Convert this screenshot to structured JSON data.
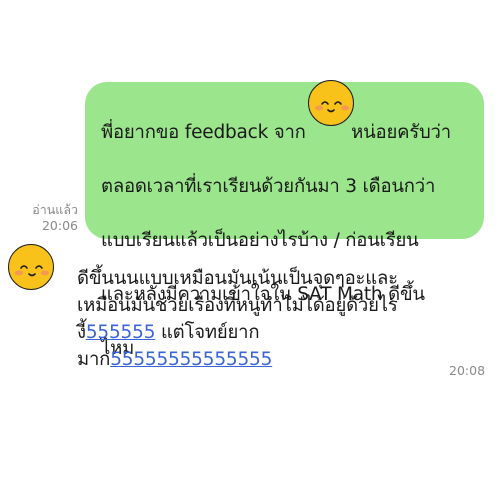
{
  "outgoing": {
    "lines": [
      "พี่อยากขอ feedback จาก        หน่อยครับว่า",
      "ตลอดเวลาที่เราเรียนด้วยกันมา 3 เดือนกว่า",
      "แบบเรียนแล้วเป็นอย่างไรบ้าง / ก่อนเรียน",
      "และหลังมีความเข้าใจใน SAT Math ดีขึ้น",
      "ไหม"
    ],
    "read_label": "อ่านแล้ว",
    "time": "20:06"
  },
  "incoming": {
    "line1": "ดีขึ้นนนแบบเหมือนมันเน้นเป็นจุดๆอะและ",
    "line2": "เหมือนมันช่วยเรื่องที่หนูทำไม่ได้อยู่ด้วยไร",
    "line3_prefix": "งี้",
    "line3_link": "555555",
    "line3_suffix": " แต่โจทย์ยาก",
    "line4_prefix": "มาก",
    "line4_link": "55555555555555",
    "time": "20:08"
  },
  "colors": {
    "outgoing_bubble": "#9be58c",
    "link": "#3a64d8",
    "emoji_fill": "#f9c21a"
  },
  "icons": {
    "sticker_emoji": "smiling-face-emoji-icon",
    "avatar": "smiling-face-avatar-icon"
  }
}
